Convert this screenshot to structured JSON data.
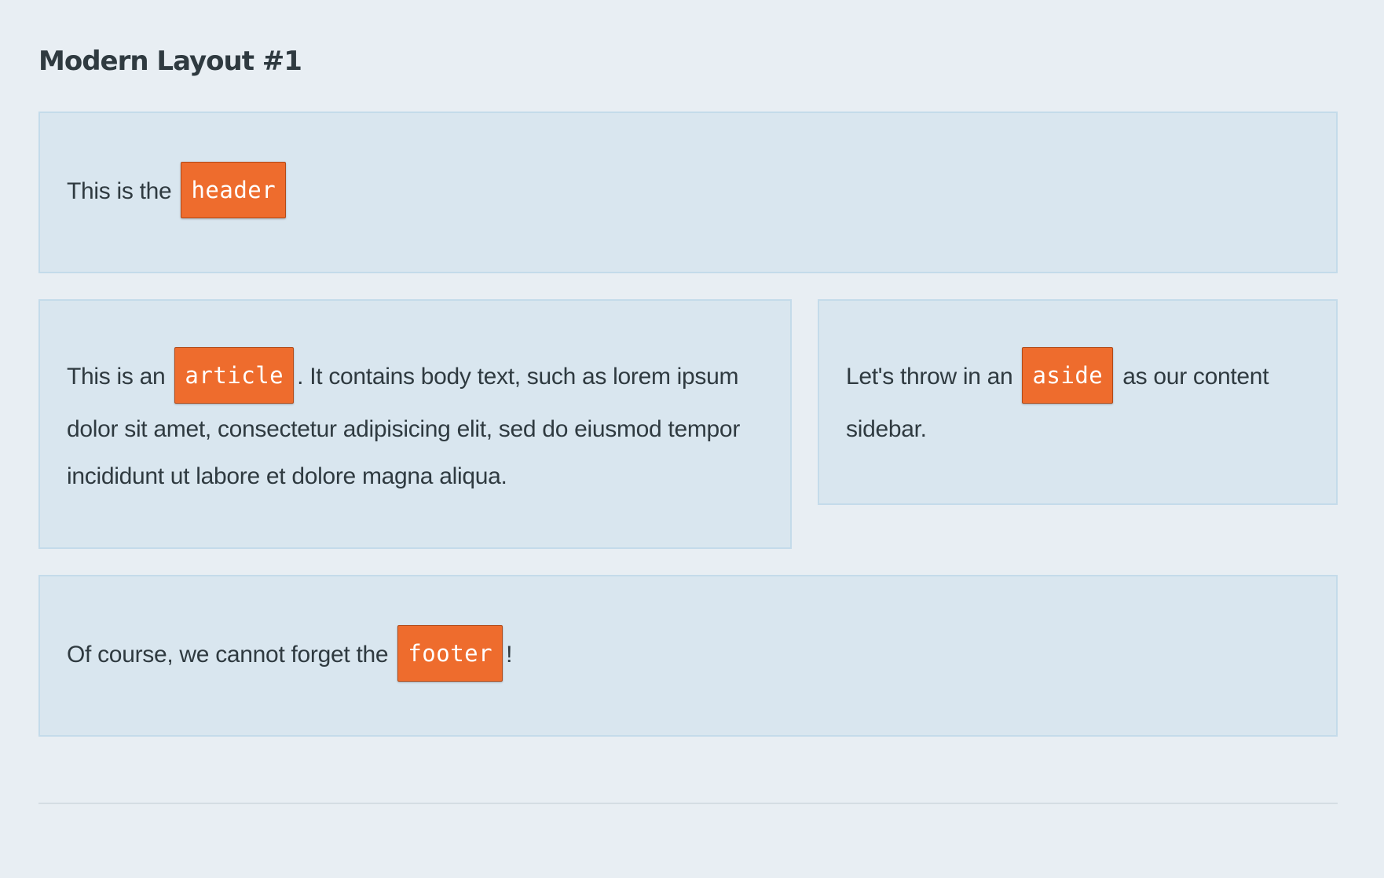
{
  "page": {
    "title": "Modern Layout #1"
  },
  "header": {
    "text_before": "This is the ",
    "tag": "header",
    "text_after": ""
  },
  "article": {
    "text_before": "This is an ",
    "tag": "article",
    "text_after": ". It contains body text, such as lorem ipsum dolor sit amet, consectetur adipisicing elit, sed do eiusmod tempor incididunt ut labore et dolore magna aliqua."
  },
  "aside": {
    "text_before": "Let's throw in an ",
    "tag": "aside",
    "text_after": " as our content sidebar."
  },
  "footer": {
    "text_before": "Of course, we cannot forget the ",
    "tag": "footer",
    "text_after": "!"
  },
  "colors": {
    "background": "#e8eef3",
    "box_background": "#d9e6ef",
    "box_border": "#c4dbea",
    "tag_background": "#ee6c2d",
    "text": "#2f3a40"
  }
}
